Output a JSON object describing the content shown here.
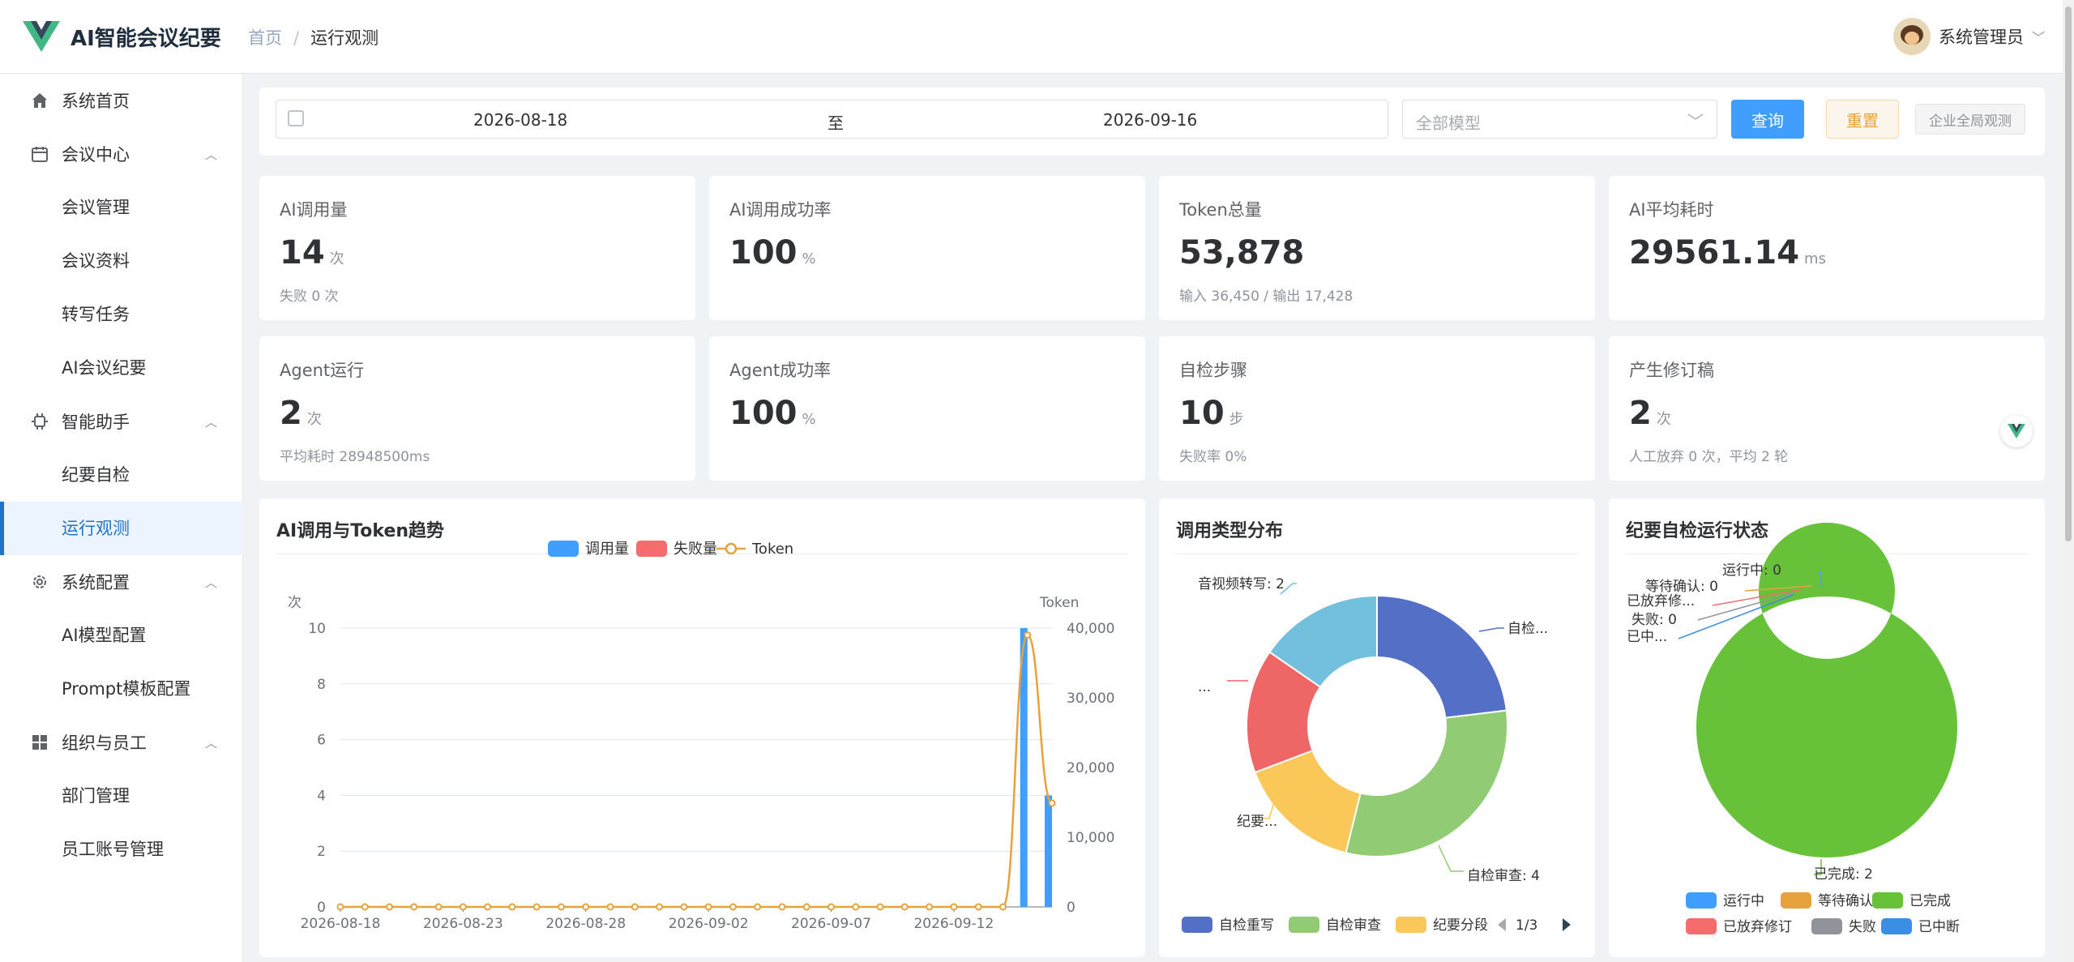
{
  "app": {
    "title": "AI智能会议纪要"
  },
  "breadcrumb": {
    "home": "首页",
    "current": "运行观测"
  },
  "user": {
    "name": "系统管理员"
  },
  "sidebar": {
    "home": "系统首页",
    "meeting_center": "会议中心",
    "meeting_mgmt": "会议管理",
    "meeting_docs": "会议资料",
    "transcribe": "转写任务",
    "ai_minutes": "AI会议纪要",
    "assistant": "智能助手",
    "self_check": "纪要自检",
    "observe": "运行观测",
    "sys_config": "系统配置",
    "ai_model": "AI模型配置",
    "prompt_tpl": "Prompt模板配置",
    "org": "组织与员工",
    "dept": "部门管理",
    "staff": "员工账号管理"
  },
  "filter": {
    "start_date": "2026-08-18",
    "to": "至",
    "end_date": "2026-09-16",
    "model_placeholder": "全部模型",
    "query": "查询",
    "reset": "重置",
    "enterprise": "企业全局观测"
  },
  "cards": [
    {
      "label": "AI调用量",
      "value": "14",
      "unit": "次",
      "sub": "失败 0 次"
    },
    {
      "label": "AI调用成功率",
      "value": "100",
      "unit": "%",
      "sub": ""
    },
    {
      "label": "Token总量",
      "value": "53,878",
      "unit": "",
      "sub": "输入 36,450 / 输出 17,428"
    },
    {
      "label": "AI平均耗时",
      "value": "29561.14",
      "unit": "ms",
      "sub": ""
    },
    {
      "label": "Agent运行",
      "value": "2",
      "unit": "次",
      "sub": "平均耗时 28948500ms"
    },
    {
      "label": "Agent成功率",
      "value": "100",
      "unit": "%",
      "sub": ""
    },
    {
      "label": "自检步骤",
      "value": "10",
      "unit": "步",
      "sub": "失败率 0%"
    },
    {
      "label": "产生修订稿",
      "value": "2",
      "unit": "次",
      "sub": "人工放弃 0 次，平均 2 轮"
    }
  ],
  "panels": {
    "trend": "AI调用与Token趋势",
    "types": "调用类型分布",
    "status": "纪要自检运行状态"
  },
  "chart_data": [
    {
      "type": "bar",
      "title": "AI调用与Token趋势",
      "ylabel_left": "次",
      "ylabel_right": "Token",
      "ylim_left": [
        0,
        10
      ],
      "ylim_right": [
        0,
        40000
      ],
      "yticks_left": [
        "0",
        "2",
        "4",
        "6",
        "8",
        "10"
      ],
      "yticks_right": [
        "0",
        "10,000",
        "20,000",
        "30,000",
        "40,000"
      ],
      "xticks": [
        "2026-08-18",
        "2026-08-23",
        "2026-08-28",
        "2026-09-02",
        "2026-09-07",
        "2026-09-12"
      ],
      "legend": [
        "调用量",
        "失败量",
        "Token"
      ],
      "calls": [
        0,
        0,
        0,
        0,
        0,
        0,
        0,
        0,
        0,
        0,
        0,
        0,
        0,
        0,
        0,
        0,
        0,
        0,
        0,
        0,
        0,
        0,
        0,
        0,
        0,
        0,
        0,
        0,
        10,
        4
      ],
      "failures": [
        0,
        0,
        0,
        0,
        0,
        0,
        0,
        0,
        0,
        0,
        0,
        0,
        0,
        0,
        0,
        0,
        0,
        0,
        0,
        0,
        0,
        0,
        0,
        0,
        0,
        0,
        0,
        0,
        0,
        0
      ],
      "tokens": [
        0,
        0,
        0,
        0,
        0,
        0,
        0,
        0,
        0,
        0,
        0,
        0,
        0,
        0,
        0,
        0,
        0,
        0,
        0,
        0,
        0,
        0,
        0,
        0,
        0,
        0,
        0,
        0,
        39000,
        14878
      ],
      "colors": {
        "calls": "#409eff",
        "failures": "#f56c6c",
        "token": "#e6a23c"
      }
    },
    {
      "type": "pie",
      "title": "调用类型分布",
      "slices": [
        {
          "label": "自检...",
          "value": 3,
          "color": "#5470c6"
        },
        {
          "label": "自检审查: 4",
          "value": 4,
          "color": "#91cc75"
        },
        {
          "label": "纪要...",
          "value": 2,
          "color": "#fac858"
        },
        {
          "label": "...",
          "value": 2,
          "color": "#ee6666"
        },
        {
          "label": "音视频转写: 2",
          "value": 2,
          "color": "#73c0de"
        }
      ],
      "legend": [
        {
          "label": "自检重写",
          "color": "#5470c6"
        },
        {
          "label": "自检审查",
          "color": "#91cc75"
        },
        {
          "label": "纪要分段",
          "color": "#fac858"
        }
      ],
      "page": "1/3"
    },
    {
      "type": "pie",
      "title": "纪要自检运行状态",
      "slices": [
        {
          "label": "运行中: 0",
          "value": 0,
          "color": "#409eff"
        },
        {
          "label": "等待确认: 0",
          "value": 0,
          "color": "#e6a23c"
        },
        {
          "label": "已放弃修...",
          "value": 0,
          "color": "#f56c6c"
        },
        {
          "label": "失败: 0",
          "value": 0,
          "color": "#909399"
        },
        {
          "label": "已中...",
          "value": 0,
          "color": "#3a8ee6"
        },
        {
          "label": "已完成: 2",
          "value": 2,
          "color": "#67c23a"
        }
      ],
      "legend": [
        {
          "label": "运行中",
          "color": "#409eff"
        },
        {
          "label": "等待确认",
          "color": "#e6a23c"
        },
        {
          "label": "已完成",
          "color": "#67c23a"
        },
        {
          "label": "已放弃修订",
          "color": "#f56c6c"
        },
        {
          "label": "失败",
          "color": "#909399"
        },
        {
          "label": "已中断",
          "color": "#3a8ee6"
        }
      ]
    }
  ]
}
